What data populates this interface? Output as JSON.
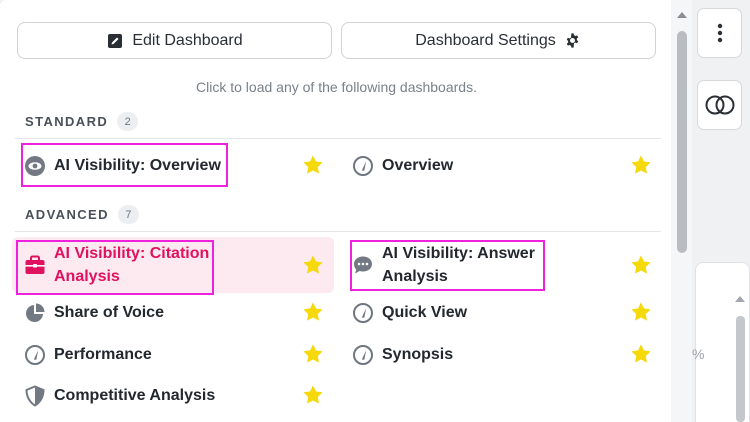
{
  "toolbar": {
    "edit_label": "Edit Dashboard",
    "settings_label": "Dashboard Settings"
  },
  "hint": "Click to load any of the following dashboards.",
  "sections": {
    "standard": {
      "label": "STANDARD",
      "count": "2"
    },
    "advanced": {
      "label": "ADVANCED",
      "count": "7"
    }
  },
  "standard_items": [
    {
      "label": "AI Visibility: Overview",
      "icon": "eye-icon",
      "starred": true
    },
    {
      "label": "Overview",
      "icon": "gauge-icon",
      "starred": true
    }
  ],
  "advanced_items": [
    {
      "label": "AI Visibility: Citation Analysis",
      "icon": "briefcase-icon",
      "starred": true,
      "highlighted": true
    },
    {
      "label": "AI Visibility: Answer Analysis",
      "icon": "chat-bubble-icon",
      "starred": true
    },
    {
      "label": "Share of Voice",
      "icon": "pie-chart-icon",
      "starred": true
    },
    {
      "label": "Quick View",
      "icon": "gauge-icon",
      "starred": true
    },
    {
      "label": "Performance",
      "icon": "gauge-icon",
      "starred": true
    },
    {
      "label": "Synopsis",
      "icon": "gauge-icon",
      "starred": true
    },
    {
      "label": "Competitive Analysis",
      "icon": "shield-icon",
      "starred": true
    }
  ],
  "side": {
    "menu_icon": "vertical-dots-icon",
    "compare_icon": "overlapping-circles-icon",
    "percent": "%"
  },
  "colors": {
    "star": "#f5d90a",
    "highlight_text": "#e0115f",
    "highlight_bg": "#fdeaf0",
    "annotation_box": "#ee22dd"
  }
}
